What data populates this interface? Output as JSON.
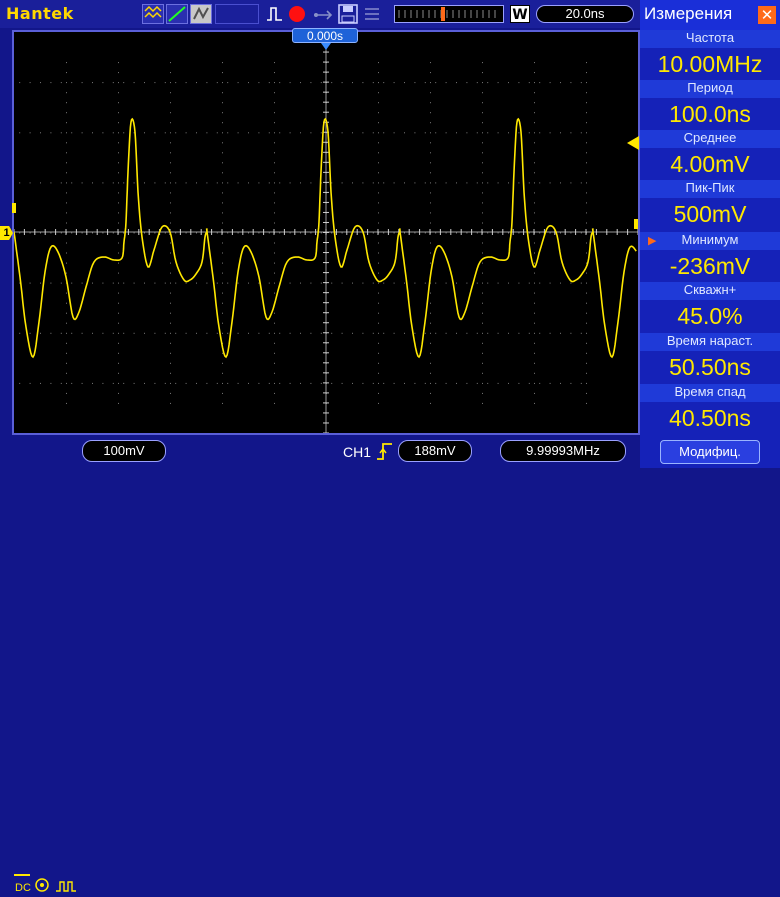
{
  "header": {
    "brand": "Hantek",
    "timebase": "20.0ns",
    "window_label": "W",
    "trigger_position": "0.000s"
  },
  "footer": {
    "coupling": "DC",
    "ch1_scale": "100mV",
    "trigger_source": "CH1",
    "trigger_level": "188mV",
    "frequency": "9.99993MHz",
    "modify_button": "Модифиц."
  },
  "panel": {
    "title": "Измерения",
    "measurements": [
      {
        "label": "Частота",
        "value": "10.00MHz"
      },
      {
        "label": "Период",
        "value": "100.0ns"
      },
      {
        "label": "Среднее",
        "value": "4.00mV"
      },
      {
        "label": "Пик-Пик",
        "value": "500mV"
      },
      {
        "label": "Минимум",
        "value": "-236mV"
      },
      {
        "label": "Скважн+",
        "value": "45.0%"
      },
      {
        "label": "Время нараст.",
        "value": "50.50ns"
      },
      {
        "label": "Время спад",
        "value": "40.50ns"
      }
    ]
  },
  "colors": {
    "trace": "#ffe800",
    "accent": "#ff6a1a",
    "panel": "#1522b8"
  },
  "channel_marker": "1"
}
